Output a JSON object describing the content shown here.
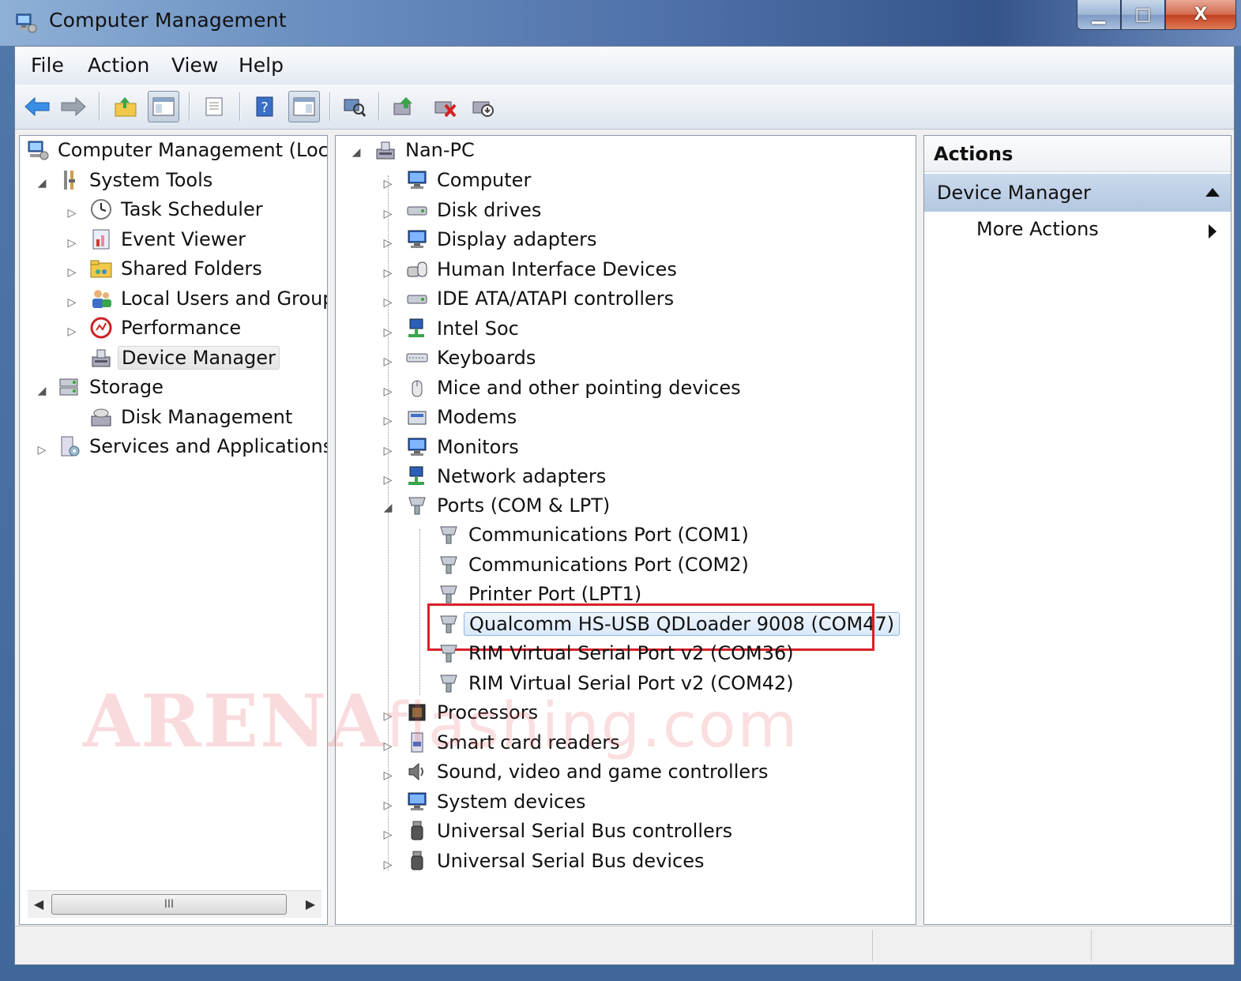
{
  "window": {
    "title": "Computer Management",
    "buttons": {
      "minimize": "▁",
      "maximize": "□",
      "close": "X"
    }
  },
  "menu": [
    "File",
    "Action",
    "View",
    "Help"
  ],
  "toolbar_icons": [
    "back-arrow-icon",
    "forward-arrow-icon",
    "up-folder-icon",
    "show-hide-console-tree-icon",
    "properties-icon",
    "help-icon",
    "show-hide-action-pane-icon",
    "scan-hardware-icon",
    "update-driver-icon",
    "uninstall-icon",
    "disable-device-icon"
  ],
  "left_tree": {
    "root": "Computer Management (Local",
    "system_tools": "System Tools",
    "system_tools_children": [
      "Task Scheduler",
      "Event Viewer",
      "Shared Folders",
      "Local Users and Groups",
      "Performance",
      "Device Manager"
    ],
    "storage": "Storage",
    "storage_children": [
      "Disk Management"
    ],
    "services": "Services and Applications",
    "scroll_thumb": "III"
  },
  "device_tree": {
    "root": "Nan-PC",
    "categories_before": [
      "Computer",
      "Disk drives",
      "Display adapters",
      "Human Interface Devices",
      "IDE ATA/ATAPI controllers",
      "Intel Soc",
      "Keyboards",
      "Mice and other pointing devices",
      "Modems",
      "Monitors",
      "Network adapters"
    ],
    "ports": "Ports (COM & LPT)",
    "ports_children": [
      "Communications Port (COM1)",
      "Communications Port (COM2)",
      "Printer Port (LPT1)",
      "Qualcomm HS-USB QDLoader 9008 (COM47)",
      "RIM Virtual Serial Port v2 (COM36)",
      "RIM Virtual Serial Port v2 (COM42)"
    ],
    "categories_after": [
      "Processors",
      "Smart card readers",
      "Sound, video and game controllers",
      "System devices",
      "Universal Serial Bus controllers",
      "Universal Serial Bus devices"
    ],
    "highlighted": "Qualcomm HS-USB QDLoader 9008 (COM47)"
  },
  "actions": {
    "header": "Actions",
    "section": "Device Manager",
    "more": "More Actions"
  },
  "watermark": {
    "big": "ARENA",
    "small": "flashing.com"
  },
  "colors": {
    "highlight_border": "#d8202a",
    "selection_bg": "#d9e8fa",
    "actions_section_bg": "#b3c7e1"
  }
}
